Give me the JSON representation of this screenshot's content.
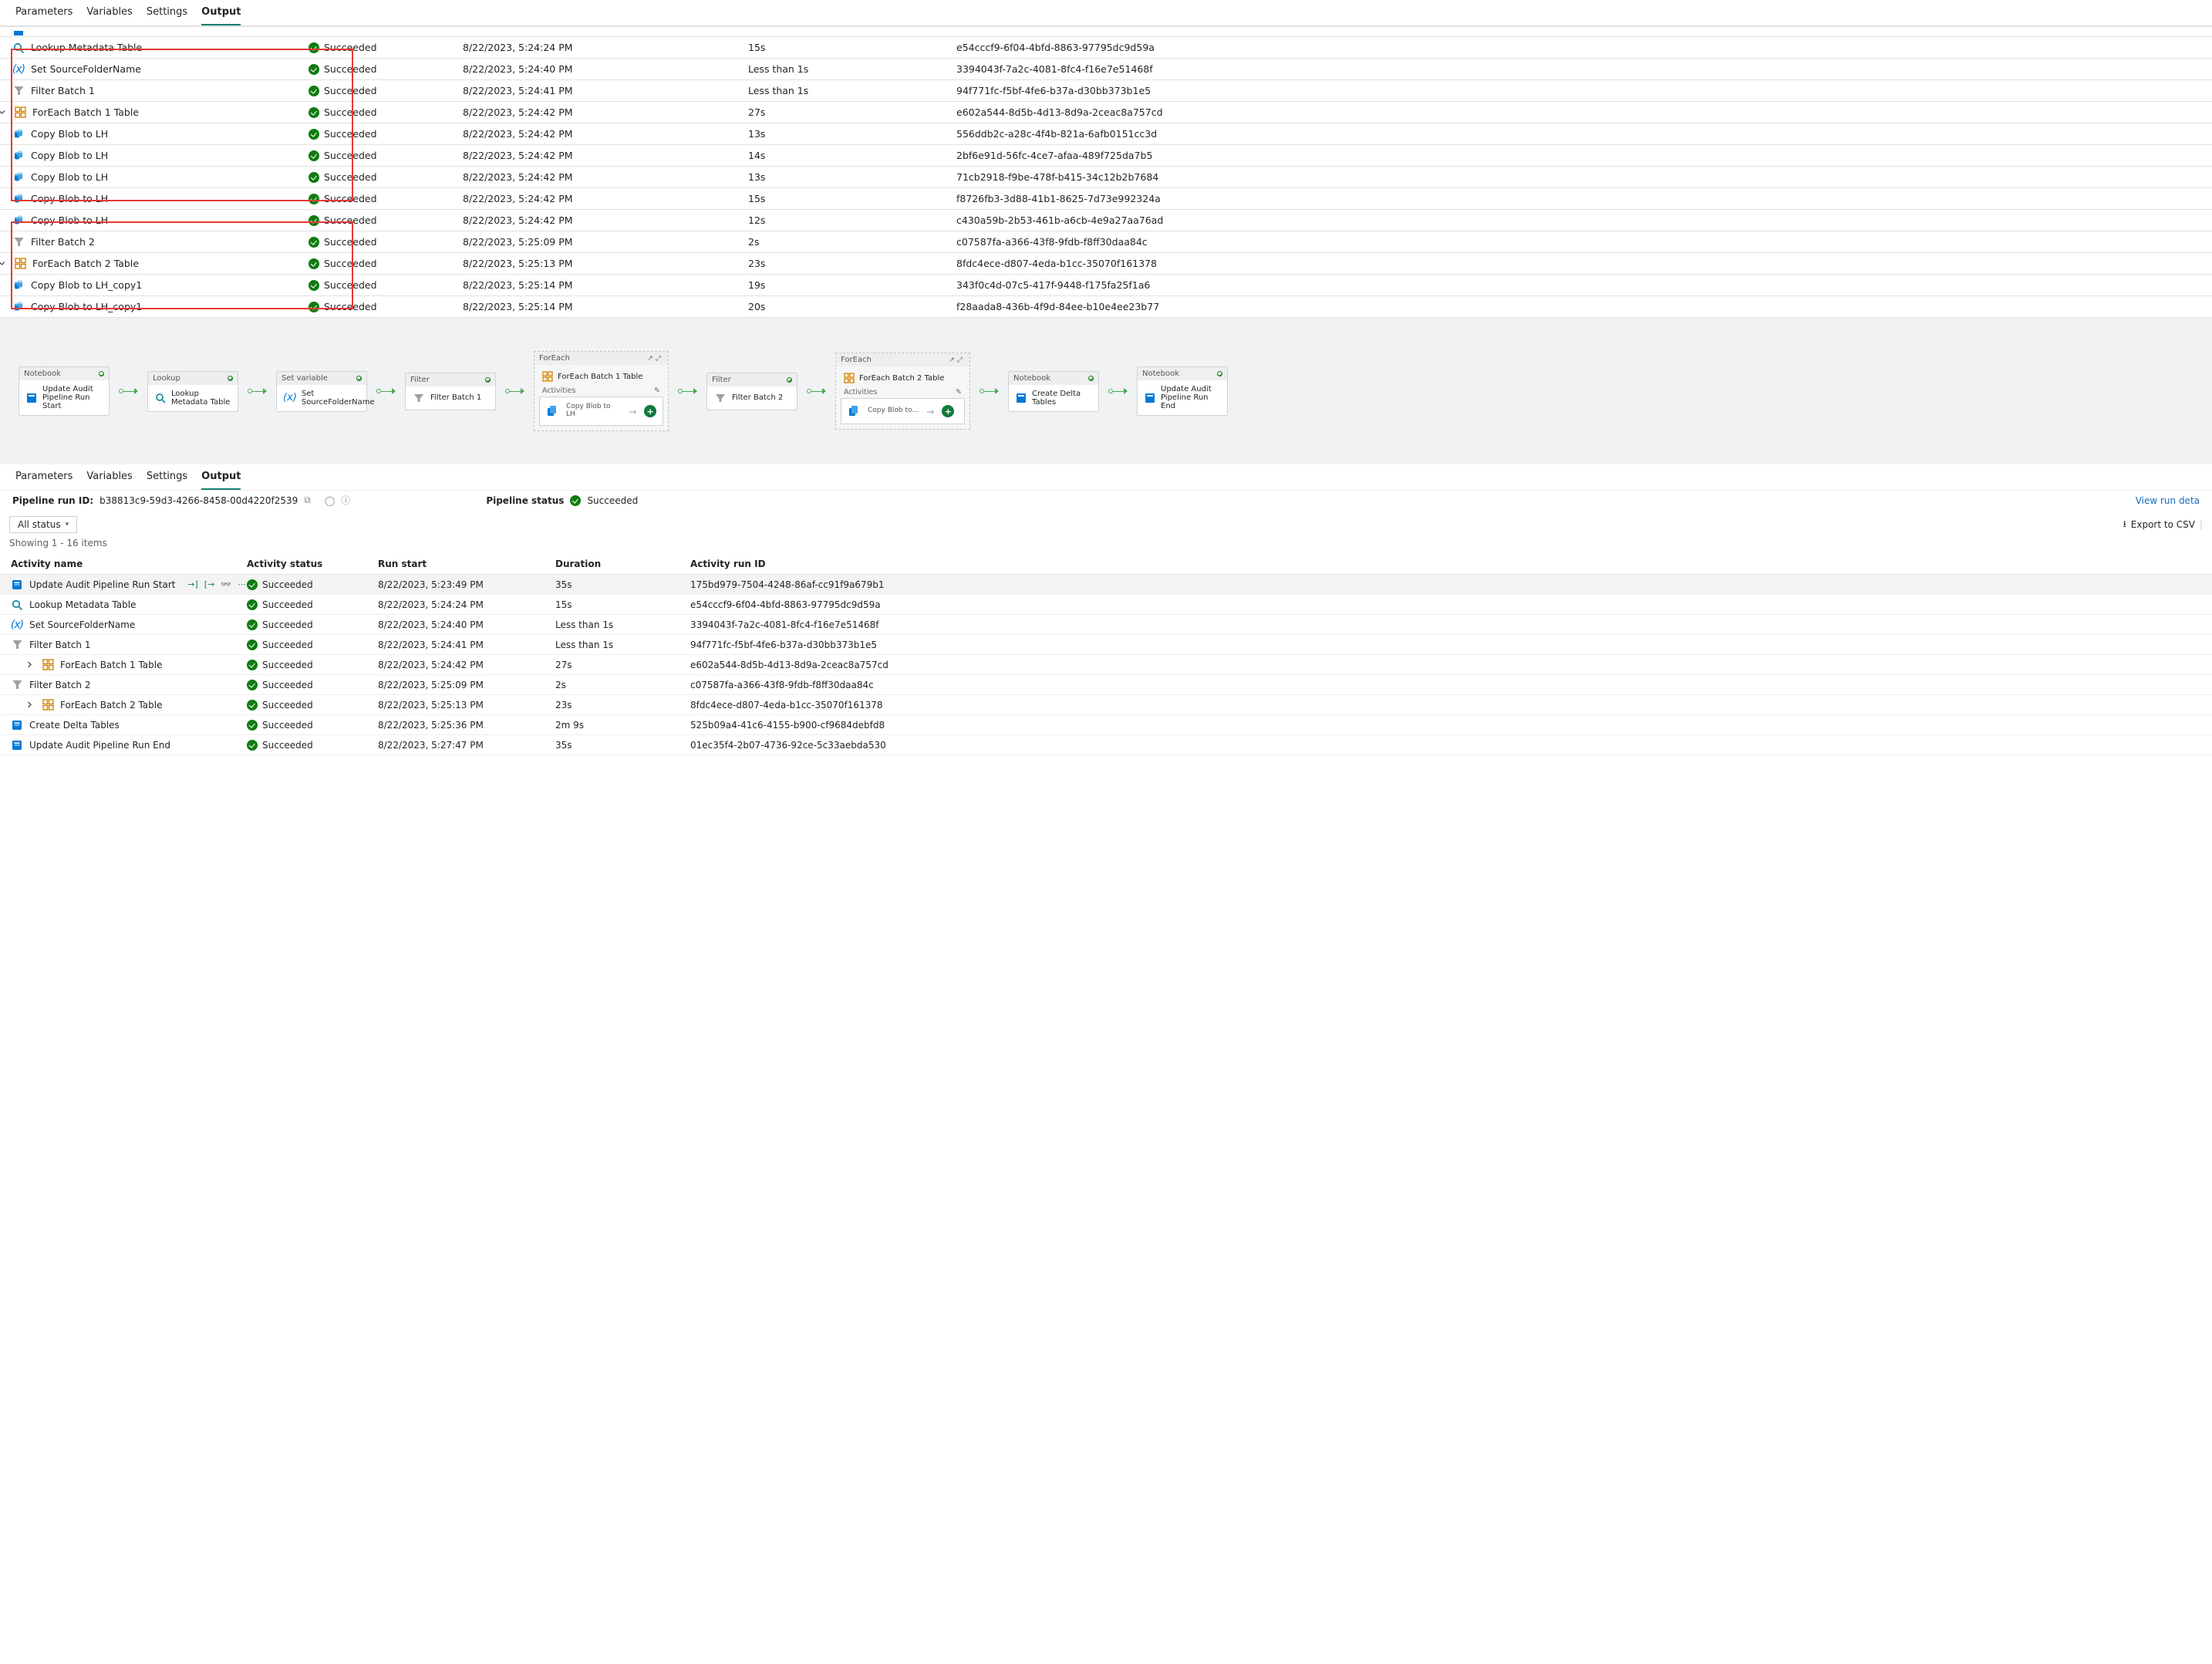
{
  "upper_tabs": {
    "parameters": "Parameters",
    "variables": "Variables",
    "settings": "Settings",
    "output": "Output"
  },
  "upper_table": {
    "rows": [
      {
        "indent": 1,
        "icon": "lookup",
        "name": "Lookup Metadata Table",
        "status": "Succeeded",
        "run_start": "8/22/2023, 5:24:24 PM",
        "duration": "15s",
        "run_id": "e54cccf9-6f04-4bfd-8863-97795dc9d59a"
      },
      {
        "indent": 1,
        "icon": "variable",
        "name": "Set SourceFolderName",
        "status": "Succeeded",
        "run_start": "8/22/2023, 5:24:40 PM",
        "duration": "Less than 1s",
        "run_id": "3394043f-7a2c-4081-8fc4-f16e7e51468f"
      },
      {
        "indent": 0,
        "icon": "filter",
        "name": "Filter Batch 1",
        "status": "Succeeded",
        "run_start": "8/22/2023, 5:24:41 PM",
        "duration": "Less than 1s",
        "run_id": "94f771fc-f5bf-4fe6-b37a-d30bb373b1e5"
      },
      {
        "indent": 1,
        "icon": "foreach",
        "chevron": "down",
        "name": "ForEach Batch 1 Table",
        "status": "Succeeded",
        "run_start": "8/22/2023, 5:24:42 PM",
        "duration": "27s",
        "run_id": "e602a544-8d5b-4d13-8d9a-2ceac8a757cd"
      },
      {
        "indent": 2,
        "icon": "copy",
        "name": "Copy Blob to LH",
        "status": "Succeeded",
        "run_start": "8/22/2023, 5:24:42 PM",
        "duration": "13s",
        "run_id": "556ddb2c-a28c-4f4b-821a-6afb0151cc3d"
      },
      {
        "indent": 2,
        "icon": "copy",
        "name": "Copy Blob to LH",
        "status": "Succeeded",
        "run_start": "8/22/2023, 5:24:42 PM",
        "duration": "14s",
        "run_id": "2bf6e91d-56fc-4ce7-afaa-489f725da7b5"
      },
      {
        "indent": 2,
        "icon": "copy",
        "name": "Copy Blob to LH",
        "status": "Succeeded",
        "run_start": "8/22/2023, 5:24:42 PM",
        "duration": "13s",
        "run_id": "71cb2918-f9be-478f-b415-34c12b2b7684"
      },
      {
        "indent": 2,
        "icon": "copy",
        "name": "Copy Blob to LH",
        "status": "Succeeded",
        "run_start": "8/22/2023, 5:24:42 PM",
        "duration": "15s",
        "run_id": "f8726fb3-3d88-41b1-8625-7d73e992324a"
      },
      {
        "indent": 2,
        "icon": "copy",
        "name": "Copy Blob to LH",
        "status": "Succeeded",
        "run_start": "8/22/2023, 5:24:42 PM",
        "duration": "12s",
        "run_id": "c430a59b-2b53-461b-a6cb-4e9a27aa76ad"
      },
      {
        "indent": 0,
        "icon": "filter",
        "name": "Filter Batch 2",
        "status": "Succeeded",
        "run_start": "8/22/2023, 5:25:09 PM",
        "duration": "2s",
        "run_id": "c07587fa-a366-43f8-9fdb-f8ff30daa84c"
      },
      {
        "indent": 1,
        "icon": "foreach",
        "chevron": "down",
        "name": "ForEach Batch 2 Table",
        "status": "Succeeded",
        "run_start": "8/22/2023, 5:25:13 PM",
        "duration": "23s",
        "run_id": "8fdc4ece-d807-4eda-b1cc-35070f161378"
      },
      {
        "indent": 2,
        "icon": "copy",
        "name": "Copy Blob to LH_copy1",
        "status": "Succeeded",
        "run_start": "8/22/2023, 5:25:14 PM",
        "duration": "19s",
        "run_id": "343f0c4d-07c5-417f-9448-f175fa25f1a6"
      },
      {
        "indent": 2,
        "icon": "copy",
        "name": "Copy Blob to LH_copy1",
        "status": "Succeeded",
        "run_start": "8/22/2023, 5:25:14 PM",
        "duration": "20s",
        "run_id": "f28aada8-436b-4f9d-84ee-b10e4ee23b77"
      }
    ]
  },
  "flow": {
    "nodes": {
      "notebook1": {
        "type": "Notebook",
        "label": "Update Audit Pipeline Run Start"
      },
      "lookup": {
        "type": "Lookup",
        "label": "Lookup Metadata Table"
      },
      "setvar": {
        "type": "Set variable",
        "label": "Set SourceFolderName"
      },
      "filter1": {
        "type": "Filter",
        "label": "Filter Batch 1"
      },
      "foreach1": {
        "type": "ForEach",
        "label": "ForEach Batch 1 Table",
        "activities_label": "Activities",
        "inner": "Copy Blob to LH"
      },
      "filter2": {
        "type": "Filter",
        "label": "Filter Batch 2"
      },
      "foreach2": {
        "type": "ForEach",
        "label": "ForEach Batch 2 Table",
        "activities_label": "Activities",
        "inner": "Copy Blob to..."
      },
      "notebook2": {
        "type": "Notebook",
        "label": "Create Delta Tables"
      },
      "notebook3": {
        "type": "Notebook",
        "label": "Update Audit Pipeline Run End"
      }
    }
  },
  "lower_tabs": {
    "parameters": "Parameters",
    "variables": "Variables",
    "settings": "Settings",
    "output": "Output"
  },
  "status_line": {
    "run_id_label": "Pipeline run ID:",
    "run_id": "b38813c9-59d3-4266-8458-00d4220f2539",
    "status_label": "Pipeline status",
    "status": "Succeeded",
    "view_link": "View run deta"
  },
  "toolbar": {
    "filter": "All status",
    "export": "Export to CSV"
  },
  "showing": "Showing 1 - 16 items",
  "lower_table": {
    "headers": {
      "name": "Activity name",
      "status": "Activity status",
      "run_start": "Run start",
      "duration": "Duration",
      "run_id": "Activity run ID"
    },
    "rows": [
      {
        "icon": "notebook",
        "chevron": "",
        "hl": true,
        "name": "Update Audit Pipeline Run Start",
        "status": "Succeeded",
        "run_start": "8/22/2023, 5:23:49 PM",
        "duration": "35s",
        "run_id": "175bd979-7504-4248-86af-cc91f9a679b1",
        "hover": true
      },
      {
        "icon": "lookup",
        "name": "Lookup Metadata Table",
        "status": "Succeeded",
        "run_start": "8/22/2023, 5:24:24 PM",
        "duration": "15s",
        "run_id": "e54cccf9-6f04-4bfd-8863-97795dc9d59a"
      },
      {
        "icon": "variable",
        "name": "Set SourceFolderName",
        "status": "Succeeded",
        "run_start": "8/22/2023, 5:24:40 PM",
        "duration": "Less than 1s",
        "run_id": "3394043f-7a2c-4081-8fc4-f16e7e51468f"
      },
      {
        "icon": "filter",
        "name": "Filter Batch 1",
        "status": "Succeeded",
        "run_start": "8/22/2023, 5:24:41 PM",
        "duration": "Less than 1s",
        "run_id": "94f771fc-f5bf-4fe6-b37a-d30bb373b1e5"
      },
      {
        "icon": "foreach",
        "chevron": "right",
        "indent": 1,
        "name": "ForEach Batch 1 Table",
        "status": "Succeeded",
        "run_start": "8/22/2023, 5:24:42 PM",
        "duration": "27s",
        "run_id": "e602a544-8d5b-4d13-8d9a-2ceac8a757cd"
      },
      {
        "icon": "filter",
        "name": "Filter Batch 2",
        "status": "Succeeded",
        "run_start": "8/22/2023, 5:25:09 PM",
        "duration": "2s",
        "run_id": "c07587fa-a366-43f8-9fdb-f8ff30daa84c"
      },
      {
        "icon": "foreach",
        "chevron": "right",
        "indent": 1,
        "name": "ForEach Batch 2 Table",
        "status": "Succeeded",
        "run_start": "8/22/2023, 5:25:13 PM",
        "duration": "23s",
        "run_id": "8fdc4ece-d807-4eda-b1cc-35070f161378"
      },
      {
        "icon": "notebook",
        "name": "Create Delta Tables",
        "status": "Succeeded",
        "run_start": "8/22/2023, 5:25:36 PM",
        "duration": "2m 9s",
        "run_id": "525b09a4-41c6-4155-b900-cf9684debfd8"
      },
      {
        "icon": "notebook",
        "name": "Update Audit Pipeline Run End",
        "status": "Succeeded",
        "run_start": "8/22/2023, 5:27:47 PM",
        "duration": "35s",
        "run_id": "01ec35f4-2b07-4736-92ce-5c33aebda530"
      }
    ]
  }
}
